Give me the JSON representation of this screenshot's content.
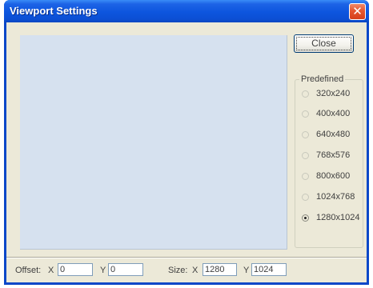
{
  "window": {
    "title": "Viewport Settings",
    "close_glyph": "✕"
  },
  "buttons": {
    "close_label": "Close"
  },
  "predefined": {
    "legend": "Predefined",
    "options": [
      {
        "label": "320x240",
        "checked": false
      },
      {
        "label": "400x400",
        "checked": false
      },
      {
        "label": "640x480",
        "checked": false
      },
      {
        "label": "768x576",
        "checked": false
      },
      {
        "label": "800x600",
        "checked": false
      },
      {
        "label": "1024x768",
        "checked": false
      },
      {
        "label": "1280x1024",
        "checked": true
      }
    ]
  },
  "status": {
    "offset_label": "Offset:",
    "offset_x_label": "X",
    "offset_x_value": "0",
    "offset_y_label": "Y",
    "offset_y_value": "0",
    "size_label": "Size:",
    "size_x_label": "X",
    "size_x_value": "1280",
    "size_y_label": "Y",
    "size_y_value": "1024"
  },
  "colors": {
    "titlebar": "#0c4fd4",
    "dialog_bg": "#ece9d8",
    "viewport_bg": "#d6e1ef",
    "close_button": "#e5562f"
  }
}
